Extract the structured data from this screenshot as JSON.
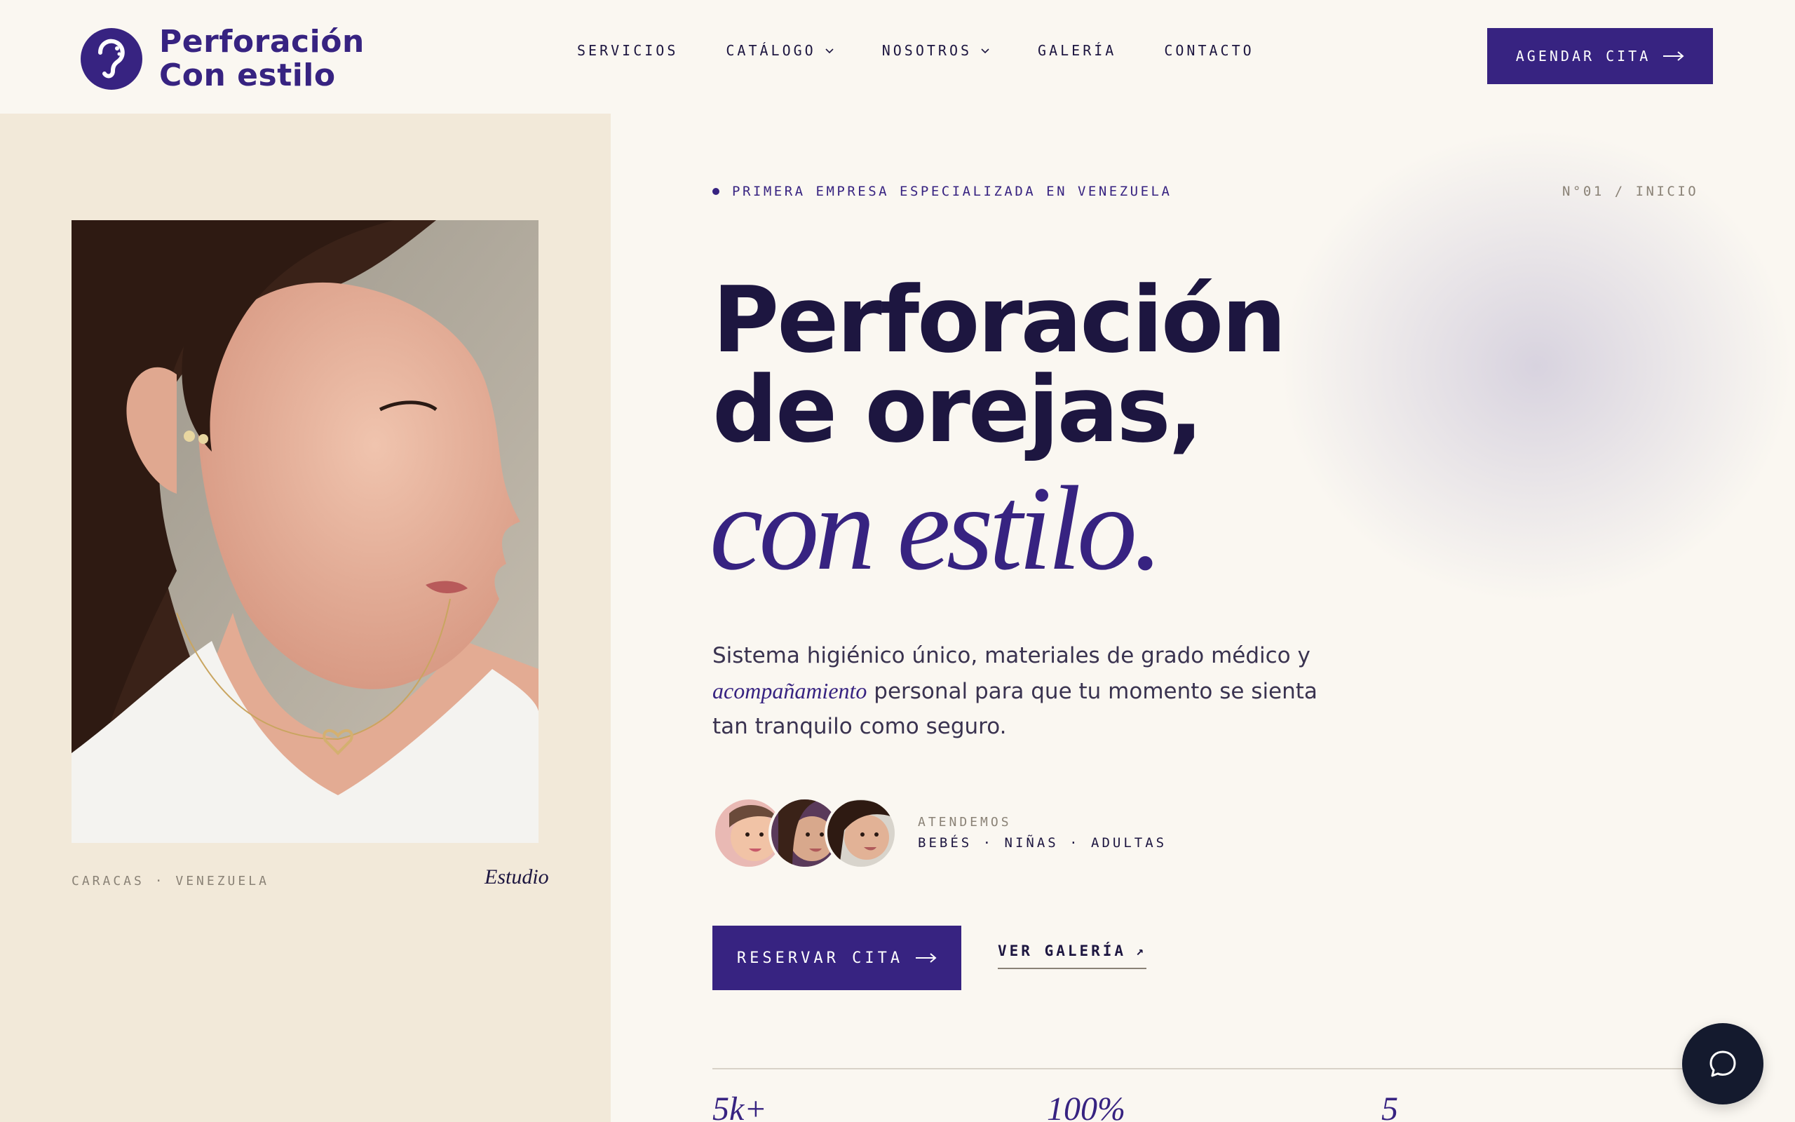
{
  "brand": {
    "line1": "Perforación",
    "line2": "Con estilo",
    "color": "#372381"
  },
  "nav": {
    "items": [
      {
        "label": "SERVICIOS",
        "has_dropdown": false
      },
      {
        "label": "CATÁLOGO",
        "has_dropdown": true
      },
      {
        "label": "NOSOTROS",
        "has_dropdown": true
      },
      {
        "label": "GALERÍA",
        "has_dropdown": false
      },
      {
        "label": "CONTACTO",
        "has_dropdown": false
      }
    ],
    "cta_label": "AGENDAR CITA"
  },
  "left": {
    "caption_left": "CARACAS · VENEZUELA",
    "caption_right": "Estudio"
  },
  "hero": {
    "eyebrow": "PRIMERA EMPRESA ESPECIALIZADA EN VENEZUELA",
    "index": "N°01 / INICIO",
    "title_line1": "Perforación",
    "title_line2": "de orejas,",
    "title_accent": "con estilo.",
    "lead_part1": "Sistema higiénico único, materiales de grado médico y ",
    "lead_em": "acompañamiento",
    "lead_part2": " personal para que tu momento se sienta tan tranquilo como seguro.",
    "audience_label": "ATENDEMOS",
    "audience_value": "BEBÉS · NIÑAS · ADULTAS",
    "primary_button": "RESERVAR CITA",
    "secondary_link": "VER GALERÍA",
    "secondary_arrow": "↗"
  },
  "stats": [
    "5k+",
    "100%",
    "5"
  ],
  "colors": {
    "accent": "#372381",
    "ink": "#1d1640",
    "cream": "#f2e9d9",
    "background": "#faf7f1",
    "chat": "#141a2e"
  }
}
